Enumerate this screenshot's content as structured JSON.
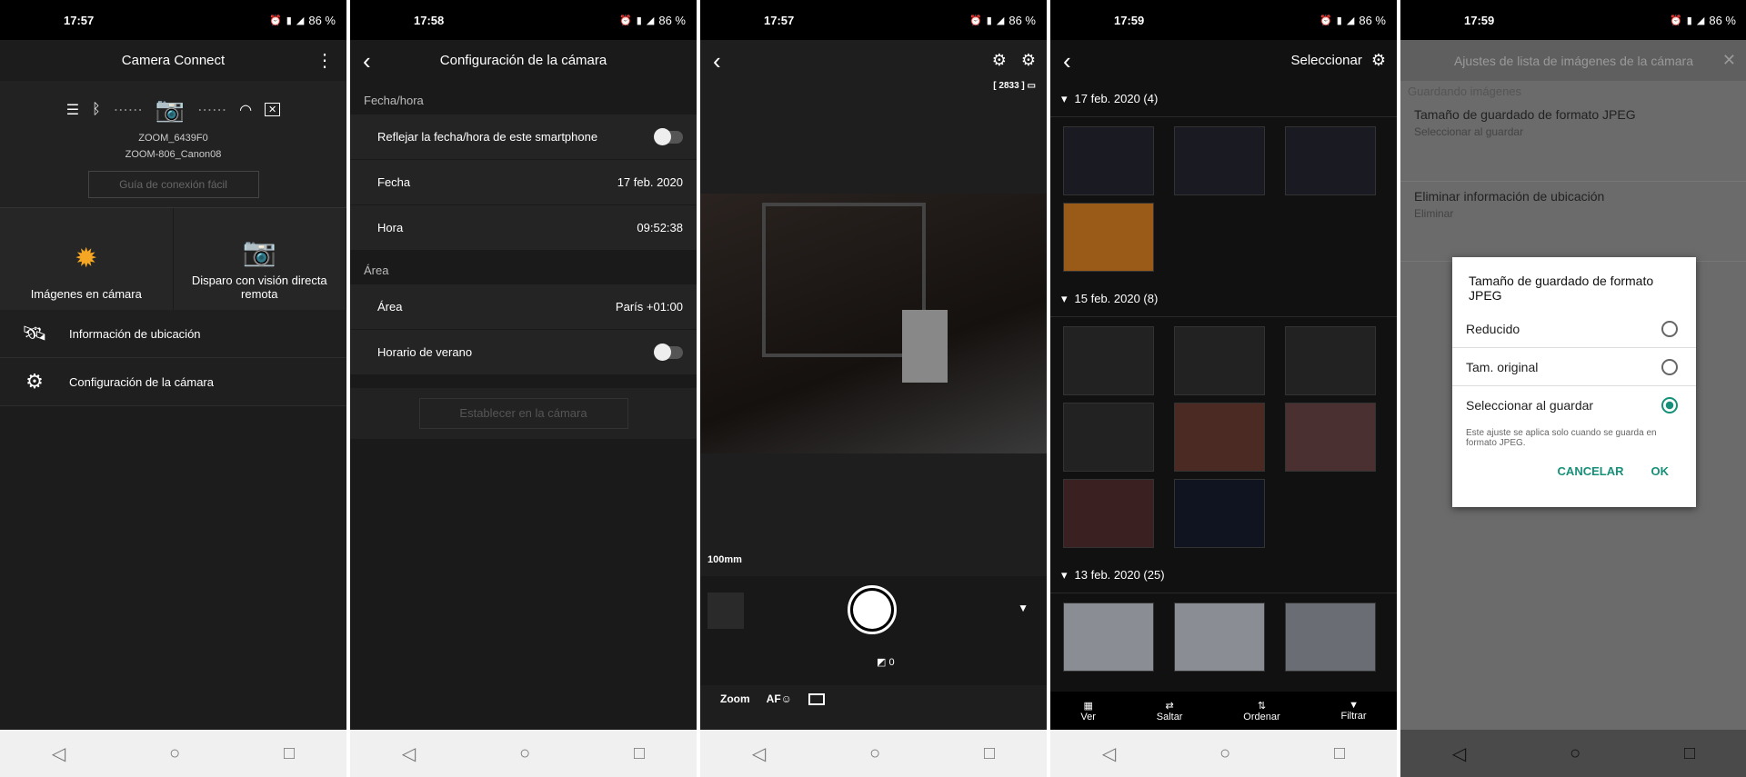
{
  "status": [
    {
      "time": "17:57",
      "battery": "86 %"
    },
    {
      "time": "17:58",
      "battery": "86 %"
    },
    {
      "time": "17:57",
      "battery": "86 %"
    },
    {
      "time": "17:59",
      "battery": "86 %"
    },
    {
      "time": "17:59",
      "battery": "86 %"
    }
  ],
  "s1": {
    "title": "Camera Connect",
    "ssid1": "ZOOM_6439F0",
    "ssid2": "ZOOM-806_Canon08",
    "guide": "Guía de conexión fácil",
    "tile1": "Imágenes en cámara",
    "tile2": "Disparo con visión directa remota",
    "item1": "Información de ubicación",
    "item2": "Configuración de la cámara"
  },
  "s2": {
    "title": "Configuración de la cámara",
    "sec1": "Fecha/hora",
    "reflect": "Reflejar la fecha/hora de este smartphone",
    "fecha_l": "Fecha",
    "fecha_v": "17 feb. 2020",
    "hora_l": "Hora",
    "hora_v": "09:52:38",
    "sec2": "Área",
    "area_l": "Área",
    "area_v": "París  +01:00",
    "summer": "Horario de verano",
    "set": "Establecer en la cámara"
  },
  "s3": {
    "shots": "[ 2833 ]",
    "focal": "100mm",
    "exp": "0",
    "zoom": "Zoom",
    "af": "AF"
  },
  "s4": {
    "select": "Seleccionar",
    "groups": [
      "17 feb. 2020 (4)",
      "15 feb. 2020 (8)",
      "13 feb. 2020 (25)"
    ],
    "bar": [
      "Ver",
      "Saltar",
      "Ordenar",
      "Filtrar"
    ]
  },
  "s5": {
    "title": "Ajustes de lista de imágenes de la cámara",
    "sec": "Guardando imágenes",
    "i1": "Tamaño de guardado de formato JPEG",
    "i1s": "Seleccionar al guardar",
    "i2": "Eliminar información de ubicación",
    "i2s": "Eliminar",
    "dlg_title": "Tamaño de guardado de formato JPEG",
    "opts": [
      "Reducido",
      "Tam. original",
      "Seleccionar al guardar"
    ],
    "note": "Este ajuste se aplica solo cuando se guarda en formato JPEG.",
    "cancel": "CANCELAR",
    "ok": "OK"
  }
}
